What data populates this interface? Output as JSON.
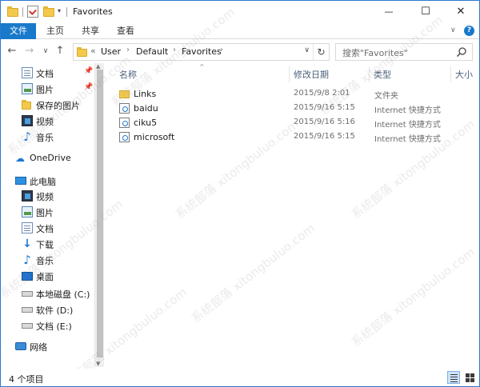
{
  "window": {
    "title": "Favorites",
    "controls": {
      "minimize": "—",
      "maximize": "☐",
      "close": "✕"
    }
  },
  "ribbon": {
    "tabs": [
      "文件",
      "主页",
      "共享",
      "查看"
    ],
    "toggle": "∨",
    "help": "?"
  },
  "address": {
    "overflow": "«",
    "crumbs": [
      "User",
      "Default",
      "Favorites"
    ],
    "separator": "›",
    "dropdown": "∨",
    "refresh": "↻"
  },
  "search": {
    "placeholder": "搜索\"Favorites\""
  },
  "nav": {
    "back": "←",
    "forward": "→",
    "recent": "∨",
    "up": "↑"
  },
  "sidebar": {
    "quick_access": [
      {
        "label": "文档",
        "icon": "document-icon",
        "pinned": true
      },
      {
        "label": "图片",
        "icon": "picture-icon",
        "pinned": true
      },
      {
        "label": "保存的图片",
        "icon": "folder-icon",
        "pinned": false
      },
      {
        "label": "视频",
        "icon": "video-icon",
        "pinned": false
      },
      {
        "label": "音乐",
        "icon": "music-icon",
        "pinned": false
      }
    ],
    "onedrive": {
      "label": "OneDrive"
    },
    "this_pc": {
      "label": "此电脑",
      "items": [
        {
          "label": "视频",
          "icon": "video-icon"
        },
        {
          "label": "图片",
          "icon": "picture-icon"
        },
        {
          "label": "文档",
          "icon": "document-icon"
        },
        {
          "label": "下载",
          "icon": "download-icon"
        },
        {
          "label": "音乐",
          "icon": "music-icon"
        },
        {
          "label": "桌面",
          "icon": "desktop-icon"
        },
        {
          "label": "本地磁盘 (C:)",
          "icon": "drive-icon"
        },
        {
          "label": "软件 (D:)",
          "icon": "drive-icon"
        },
        {
          "label": "文档 (E:)",
          "icon": "drive-icon"
        }
      ]
    },
    "network": {
      "label": "网络"
    },
    "pin_glyph": "📌"
  },
  "columns": {
    "name": "名称",
    "modified": "修改日期",
    "type": "类型",
    "size": "大小",
    "sort_arrow": "^"
  },
  "files": [
    {
      "name": "Links",
      "modified": "2015/9/8 2:01",
      "type": "文件夹",
      "icon": "folder-icon"
    },
    {
      "name": "baidu",
      "modified": "2015/9/16 5:15",
      "type": "Internet 快捷方式",
      "icon": "url-shortcut-icon"
    },
    {
      "name": "ciku5",
      "modified": "2015/9/16 5:16",
      "type": "Internet 快捷方式",
      "icon": "url-shortcut-icon"
    },
    {
      "name": "microsoft",
      "modified": "2015/9/16 5:15",
      "type": "Internet 快捷方式",
      "icon": "url-shortcut-icon"
    }
  ],
  "status": {
    "item_count": "4 个项目"
  },
  "watermark": "系统部落 xitongbuluo.com"
}
